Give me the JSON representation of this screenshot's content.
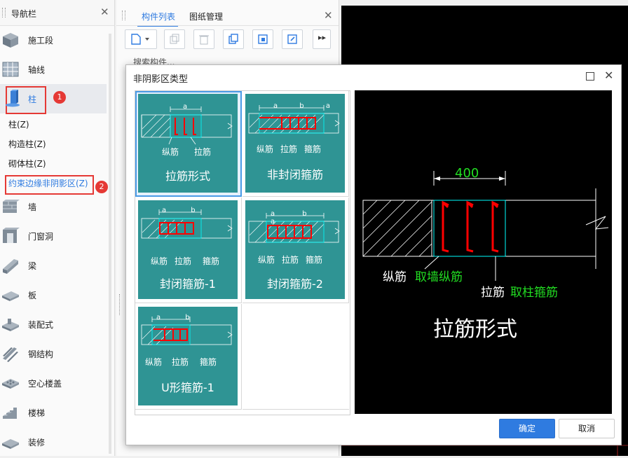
{
  "nav": {
    "title": "导航栏",
    "items": [
      {
        "label": "施工段",
        "icon": "construction-segment-icon"
      },
      {
        "label": "轴线",
        "icon": "axis-grid-icon"
      },
      {
        "label": "柱",
        "icon": "column-icon"
      },
      {
        "label": "墙",
        "icon": "wall-icon"
      },
      {
        "label": "门窗洞",
        "icon": "door-window-icon"
      },
      {
        "label": "梁",
        "icon": "beam-icon"
      },
      {
        "label": "板",
        "icon": "slab-icon"
      },
      {
        "label": "装配式",
        "icon": "prefab-icon"
      },
      {
        "label": "钢结构",
        "icon": "steel-structure-icon"
      },
      {
        "label": "空心楼盖",
        "icon": "hollow-floor-icon"
      },
      {
        "label": "楼梯",
        "icon": "stair-icon"
      },
      {
        "label": "装修",
        "icon": "decoration-icon"
      }
    ],
    "sub_items": [
      "柱(Z)",
      "构造柱(Z)",
      "砌体柱(Z)",
      "约束边缘非阴影区(Z)"
    ],
    "markers": [
      "1",
      "2"
    ]
  },
  "mid": {
    "tabs": [
      "构件列表",
      "图纸管理"
    ],
    "partial_text": "搜索构件..."
  },
  "dialog": {
    "title": "非阴影区类型",
    "options": [
      {
        "caption": "拉筋形式",
        "labels": [
          "纵筋",
          "拉筋"
        ],
        "dims": "a"
      },
      {
        "caption": "非封闭箍筋",
        "labels": [
          "纵筋",
          "拉筋",
          "箍筋"
        ],
        "dims": "a b a"
      },
      {
        "caption": "封闭箍筋-1",
        "labels": [
          "纵筋",
          "拉筋",
          "箍筋"
        ],
        "dims": "a b"
      },
      {
        "caption": "封闭箍筋-2",
        "labels": [
          "纵筋",
          "拉筋",
          "箍筋"
        ],
        "dims": "a b a"
      },
      {
        "caption": "U形箍筋-1",
        "labels": [
          "纵筋",
          "拉筋",
          "箍筋"
        ],
        "dims": "a b"
      }
    ],
    "preview": {
      "dimension": "400",
      "label1": "纵筋",
      "label1_note": "取墙纵筋",
      "label2": "拉筋",
      "label2_note": "取柱箍筋",
      "caption": "拉筋形式"
    },
    "ok_label": "确定",
    "cancel_label": "取消"
  },
  "colors": {
    "accent": "#2f7be0",
    "card": "#2f9494",
    "marker": "#e53935",
    "rebar": "#ff0000",
    "dim_green": "#22dd22"
  }
}
